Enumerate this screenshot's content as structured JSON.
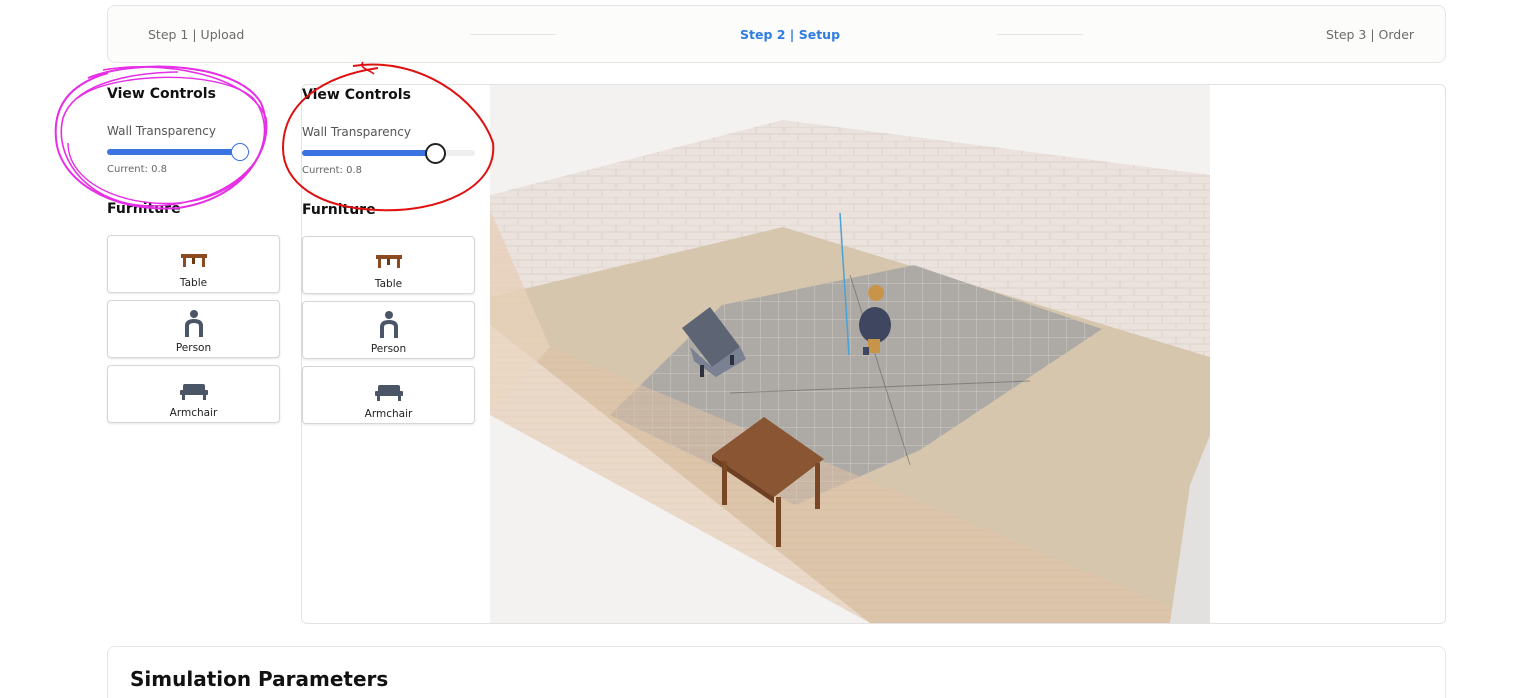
{
  "stepper": {
    "steps": [
      {
        "label": "Step 1 | Upload",
        "active": false
      },
      {
        "label": "Step 2 | Setup",
        "active": true
      },
      {
        "label": "Step 3 | Order",
        "active": false
      }
    ]
  },
  "left_panel": {
    "view_controls_title": "View Controls",
    "wall_transparency_label": "Wall Transparency",
    "wall_transparency_value": 0.8,
    "current_text": "Current: 0.8",
    "furniture_title": "Furniture",
    "furniture": [
      {
        "label": "Table",
        "icon": "table-icon"
      },
      {
        "label": "Person",
        "icon": "person-icon"
      },
      {
        "label": "Armchair",
        "icon": "armchair-icon"
      }
    ]
  },
  "inner_panel": {
    "view_controls_title": "View Controls",
    "wall_transparency_label": "Wall Transparency",
    "wall_transparency_value": 0.8,
    "current_text": "Current: 0.8",
    "furniture_title": "Furniture",
    "furniture": [
      {
        "label": "Table",
        "icon": "table-icon"
      },
      {
        "label": "Person",
        "icon": "person-icon"
      },
      {
        "label": "Armchair",
        "icon": "armchair-icon"
      }
    ]
  },
  "simulation": {
    "title": "Simulation Parameters"
  },
  "colors": {
    "accent": "#3b73e0",
    "active_step": "#2f7de1",
    "annotation_magenta": "#e62ee6",
    "annotation_red": "#e01010",
    "table_brown": "#8b4a1f",
    "person_slate": "#4a5566"
  }
}
